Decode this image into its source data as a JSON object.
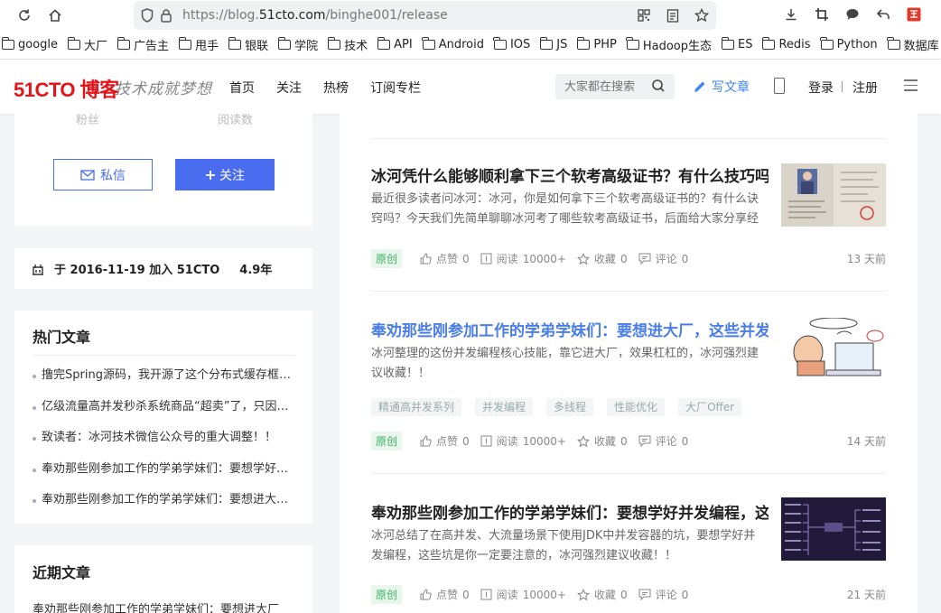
{
  "browser": {
    "url_prefix": "https://blog.",
    "url_domain": "51cto.com",
    "url_path": "/binghe001/release"
  },
  "bookmarks": [
    "google",
    "大厂",
    "广告主",
    "甩手",
    "银联",
    "学院",
    "技术",
    "API",
    "Android",
    "IOS",
    "JS",
    "PHP",
    "Hadoop生态",
    "ES",
    "Redis",
    "Python",
    "数据库"
  ],
  "header": {
    "logo": "51CTO 博客",
    "slogan": "技术成就梦想",
    "nav": [
      "首页",
      "关注",
      "热榜",
      "订阅专栏"
    ],
    "search_placeholder": "大家都在搜索",
    "write": "写文章",
    "login": "登录",
    "register": "注册"
  },
  "profile": {
    "faded_stats": [
      "粉丝",
      "阅读数"
    ],
    "message": "私信",
    "follow": "关注"
  },
  "join": {
    "text": "于 2016-11-19 加入 51CTO",
    "years": "4.9年"
  },
  "hot": {
    "title": "热门文章",
    "items": [
      "撸完Spring源码，我开源了这个分布式缓存框架！",
      "亿级流量高并发秒杀系统商品“超卖”了，只因使用的JDK同步容器Vector有这两个问题！",
      "致读者：冰河技术微信公众号的重大调整！！",
      "奉劝那些刚参加工作的学弟学妹们：要想学好并发编程，这些并发容器的坑是你一定要注意的！",
      "奉劝那些刚参加工作的学弟学妹们：要想进大厂，这些并发编程知识是你必须要掌握的！"
    ]
  },
  "recent": {
    "title": "近期文章",
    "first": "奉劝那些刚参加工作的学弟学妹们：要想进大厂"
  },
  "articles": [
    {
      "title": "冰河凭什么能够顺利拿下三个软考高级证书？有什么技巧吗？",
      "summary": "最近很多读者问冰河：冰河，你是如何拿下三个软考高级证书的？有什么诀窍吗？今天我们先简单聊聊冰河考了哪些软考高级证书，后面给大家分享经验。",
      "badge": "原创",
      "likes_label": "点赞",
      "likes": "0",
      "reads_label": "阅读",
      "reads": "10000+",
      "fav_label": "收藏",
      "favs": "0",
      "comment_label": "评论",
      "comments": "0",
      "time": "13 天前"
    },
    {
      "title": "奉劝那些刚参加工作的学弟学妹们：要想进大厂，这些并发编程知识是你必须要掌握的！",
      "summary": "冰河整理的这份并发编程核心技能，靠它进大厂，效果杠杠的，冰河强烈建议收藏！！",
      "tags": [
        "精通高并发系列",
        "并发编程",
        "多线程",
        "性能优化",
        "大厂Offer"
      ],
      "badge": "原创",
      "likes_label": "点赞",
      "likes": "0",
      "reads_label": "阅读",
      "reads": "10000+",
      "fav_label": "收藏",
      "favs": "0",
      "comment_label": "评论",
      "comments": "0",
      "time": "14 天前"
    },
    {
      "title": "奉劝那些刚参加工作的学弟学妹们：要想学好并发编程，这些并发容器的坑是你一定要注意的！",
      "summary": "冰河总结了在高并发、大流量场景下使用JDK中并发容器的坑，要想学好并发编程，这些坑是你一定要注意的，冰河强烈建议收藏！！",
      "badge": "原创",
      "likes_label": "点赞",
      "likes": "0",
      "reads_label": "阅读",
      "reads": "10000+",
      "fav_label": "收藏",
      "favs": "0",
      "comment_label": "评论",
      "comments": "0",
      "time": "21 天前"
    }
  ],
  "colors": {
    "accent": "#4a6df0",
    "logo_red": "#e4141b",
    "highlight_title": "#4a7ee6",
    "badge_green": "#3cb063"
  }
}
